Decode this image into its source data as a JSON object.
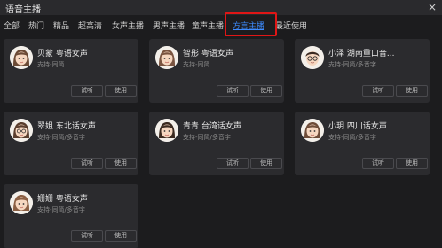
{
  "window": {
    "title": "语音主播",
    "close_glyph": "×"
  },
  "tabs": [
    {
      "label": "全部"
    },
    {
      "label": "热门"
    },
    {
      "label": "精品"
    },
    {
      "label": "超高清"
    },
    {
      "label": "女声主播"
    },
    {
      "label": "男声主播"
    },
    {
      "label": "童声主播"
    },
    {
      "label": "方言主播",
      "active": true
    },
    {
      "label": "最近使用"
    }
  ],
  "highlight_color": "#e01616",
  "accent_color": "#3d8bff",
  "buttons": {
    "listen": "试听",
    "use": "使用"
  },
  "voices": [
    {
      "name": "贝蒙 粤语女声",
      "support": "支持-同简",
      "avatar": "female-icon"
    },
    {
      "name": "智彤 粤语女声",
      "support": "支持-同简",
      "avatar": "female-icon"
    },
    {
      "name": "小泽 湖南重口音...",
      "support": "支持-同简/多音字",
      "avatar": "male-glasses-icon"
    },
    {
      "name": "翠姐 东北话女声",
      "support": "支持-同简/多音字",
      "avatar": "female-glasses-icon"
    },
    {
      "name": "青青 台湾话女声",
      "support": "支持-同简/多音字",
      "avatar": "female-icon"
    },
    {
      "name": "小玥 四川话女声",
      "support": "支持-同简/多音字",
      "avatar": "female-icon"
    },
    {
      "name": "姗姗 粤语女声",
      "support": "支持-同简/多音字",
      "avatar": "female-icon"
    }
  ]
}
